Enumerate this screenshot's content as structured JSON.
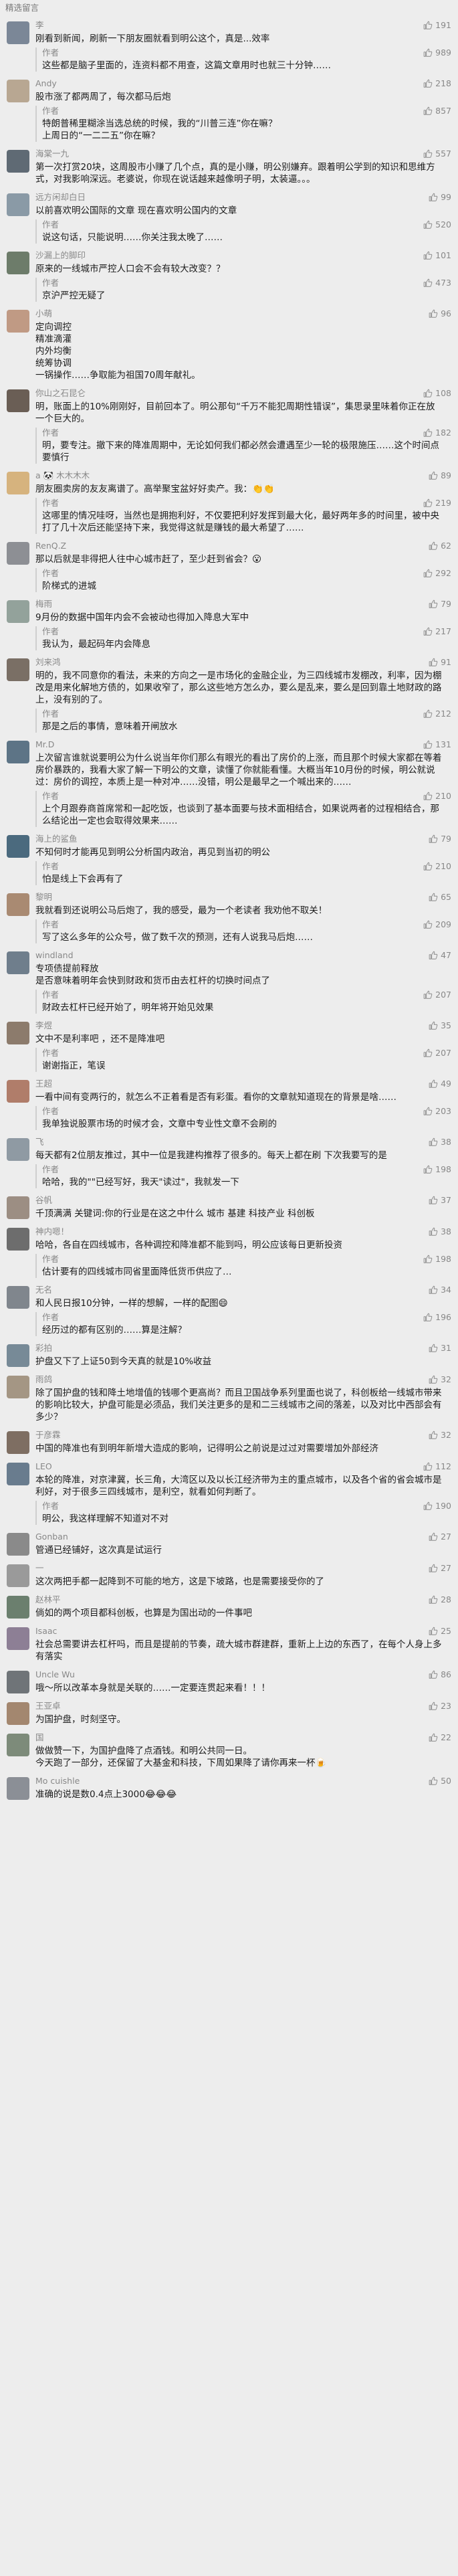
{
  "header": {
    "title": "精选留言"
  },
  "author_label": "作者",
  "comments": [
    {
      "name": "李",
      "likes": "191",
      "avatar_color": "#7b8797",
      "content": "刚看到新闻，刷新一下朋友圈就看到明公这个，真是...效率",
      "reply": {
        "likes": "989",
        "content": "这些都是脑子里面的，连资料都不用查，这篇文章用时也就三十分钟……"
      }
    },
    {
      "name": "Andy",
      "likes": "218",
      "avatar_color": "#b8a792",
      "content": "股市涨了都两周了，每次都马后炮",
      "reply": {
        "likes": "857",
        "content": "特朗普稀里糊涂当选总统的时候，我的“川普三连”你在嘛？\n上周日的“一二二五”你在嘛？"
      }
    },
    {
      "name": "海棠一九",
      "likes": "557",
      "avatar_color": "#5f6a74",
      "content": "第一次打赏20块，这周股市小赚了几个点，真的是小赚，明公别嫌弃。跟着明公学到的知识和思维方式，对我影响深远。老婆说，你现在说话越来越像明子明，太装逼。。。",
      "reply": null
    },
    {
      "name": "远方闲却白日",
      "likes": "99",
      "avatar_color": "#8a9aa6",
      "content": "以前喜欢明公国际的文章  现在喜欢明公国内的文章",
      "reply": {
        "likes": "520",
        "content": "说这句话，只能说明……你关注我太晚了……"
      }
    },
    {
      "name": "沙漏上的脚印",
      "likes": "101",
      "avatar_color": "#6d7c6a",
      "content": "原来的一线城市严控人口会不会有较大改变？？",
      "reply": {
        "likes": "473",
        "content": "京沪严控无疑了"
      }
    },
    {
      "name": "小萌",
      "likes": "96",
      "avatar_color": "#c09a84",
      "content": "定向调控\n精准滴灌\n内外均衡\n统筹协调\n一锅操作……争取能为祖国70周年献礼。",
      "reply": null
    },
    {
      "name": "你山之石昆仑",
      "likes": "108",
      "avatar_color": "#6a5e55",
      "content": "明，账面上的10%刚刚好，目前回本了。明公那句“千万不能犯周期性错误”，集思录里味着你正在放一个巨大的。",
      "reply": {
        "likes": "182",
        "content": "明，要专注。撤下来的降准周期中，无论如何我们都必然会遭遇至少一轮的极限施压……这个时间点要慎行"
      }
    },
    {
      "name": "a 🐼 木木木木",
      "likes": "89",
      "avatar_color": "#d6b37e",
      "content": "朋友圈卖房的友友离谱了。高举聚宝盆好好卖产。我：👏👏",
      "reply": {
        "likes": "219",
        "content": "这哪里的情况哇呀，当然也是拥抱利好，不仅要把利好发挥到最大化，最好两年多的时间里，被中央打了几十次后还能坚持下来，我觉得这就是赚钱的最大希望了……"
      }
    },
    {
      "name": "RenQ.Z",
      "likes": "62",
      "avatar_color": "#8d8f94",
      "content": "那以后就是非得把人往中心城市赶了，至少赶到省会？😮",
      "reply": {
        "likes": "292",
        "content": "阶梯式的进城"
      }
    },
    {
      "name": "梅雨",
      "likes": "79",
      "avatar_color": "#93a29b",
      "content": "9月份的数据中国年内会不会被动也得加入降息大军中",
      "reply": {
        "likes": "217",
        "content": "我认为，最起码年内会降息"
      }
    },
    {
      "name": "刘来鸿",
      "likes": "91",
      "avatar_color": "#7a6f65",
      "content": "明的，我不同意你的看法，未来的方向之一是市场化的金融企业，为三四线城市发棚改，利率，因为棚改是用来化解地方债的，如果收窄了，那么这些地方怎么办，要么是乱来，要么是回到靠土地财政的路上，没有别的了。",
      "reply": {
        "likes": "212",
        "content": "那是之后的事情，意味着开闸放水"
      }
    },
    {
      "name": "Mr.D",
      "likes": "131",
      "avatar_color": "#5d7486",
      "content": "上次留言谁就说要明公为什么说当年你们那么有眼光的看出了房价的上涨，而且那个时候大家都在等着房价暴跌的，我看大家了解一下明公的文章，读懂了你就能看懂。大概当年10月份的时候，明公就说过：房价的调控，本质上是一种对冲……没错，明公是最早之一个喊出来的……",
      "reply": {
        "likes": "210",
        "content": "上个月跟券商首席常和一起吃饭，也谈到了基本面要与技术面相结合，如果说两者的过程相结合，那么结论出一定也会取得效果来……"
      }
    },
    {
      "name": "海上的鲨鱼",
      "likes": "79",
      "avatar_color": "#4b6a7e",
      "content": "不知何时才能再见到明公分析国内政治，再见到当初的明公",
      "reply": {
        "likes": "210",
        "content": "怕是线上下会再有了"
      }
    },
    {
      "name": "黎明",
      "likes": "65",
      "avatar_color": "#a98a72",
      "content": "我就看到还说明公马后炮了，我的感受，最为一个老读者 我劝他不取关！",
      "reply": {
        "likes": "209",
        "content": "写了这么多年的公众号，做了数千次的预测，还有人说我马后炮……"
      }
    },
    {
      "name": "windland",
      "likes": "47",
      "avatar_color": "#6f7e8c",
      "content": "专项债提前释放\n是否意味着明年会快到财政和货币由去杠杆的切换时间点了",
      "reply": {
        "likes": "207",
        "content": "财政去杠杆已经开始了，明年将开始见效果"
      }
    },
    {
      "name": "李煜",
      "likes": "35",
      "avatar_color": "#8c7b6c",
      "content": "文中不是利率吧 ，还不是降准吧",
      "reply": {
        "likes": "207",
        "content": "谢谢指正，笔误"
      }
    },
    {
      "name": "王超",
      "likes": "49",
      "avatar_color": "#b07d6a",
      "content": "一看中间有变两行的，就怎么不正着看是否有彩蛋。看你的文章就知道现在的背景是啥……",
      "reply": {
        "likes": "203",
        "content": "我单独说股票市场的时候才会，文章中专业性文章不会刷的"
      }
    },
    {
      "name": "飞",
      "likes": "38",
      "avatar_color": "#8f9aa3",
      "content": "每天都有2位朋友推过，其中一位是我建构推荐了很多的。每天上都在刷 下次我要写的是",
      "reply": {
        "likes": "198",
        "content": "哈哈，我的\"\"已经写好，我天\"读过\"，我就发一下"
      }
    },
    {
      "name": "谷帆",
      "likes": "37",
      "avatar_color": "#9c8e83",
      "content": "千顶满满 关键词:你的行业是在这之中什么  城市  基建  科技产业  科创板",
      "reply": null
    },
    {
      "name": "神内嗯！",
      "likes": "38",
      "avatar_color": "#6d6d6d",
      "content": "哈哈，各自在四线城市，各种调控和降准都不能到吗，明公应该每日更新投资",
      "reply": {
        "likes": "198",
        "content": "估计要有的四线城市同省里面降低货币供应了…"
      }
    },
    {
      "name": "无名",
      "likes": "34",
      "avatar_color": "#80868d",
      "content": "和人民日报10分钟，一样的想解，一样的配图😄",
      "reply": {
        "likes": "196",
        "content": "经历过的都有区别的……算是注解？"
      }
    },
    {
      "name": "彩拍",
      "likes": "31",
      "avatar_color": "#778a97",
      "content": "护盘又下了上证50到今天真的就是10%收益",
      "reply": null
    },
    {
      "name": "雨鸽",
      "likes": "32",
      "avatar_color": "#a49684",
      "content": "除了国护盘的钱和降土地增值的钱哪个更高尚？而且卫国战争系列里面也说了，科创板给一线城市带来的影响比较大，护盘可能是必须品，我们关注更多的是和二三线城市之间的落差，以及对比中西部会有多少？",
      "reply": null
    },
    {
      "name": "于彦霖",
      "likes": "32",
      "avatar_color": "#7e6e62",
      "content": "中国的降准也有到明年新增大造成的影响，记得明公之前说是过过对需要增加外部经济",
      "reply": null
    },
    {
      "name": "LEO",
      "likes": "112",
      "avatar_color": "#697c8e",
      "content": "本轮的降准，对京津冀，长三角，大湾区以及以长江经济带为主的重点城市，以及各个省的省会城市是利好，对于很多三四线城市，是利空，就看如何判断了。",
      "reply": {
        "likes": "190",
        "content": "明公，我这样理解不知道对不对"
      }
    },
    {
      "name": "Gonban",
      "likes": "27",
      "avatar_color": "#8a8a8a",
      "content": "管通已经铺好，这次真是试运行",
      "reply": null
    },
    {
      "name": "一",
      "likes": "27",
      "avatar_color": "#9a9a9a",
      "content": "这次两把手都一起降到不可能的地方，这是下坡路，也是需要接受你的了",
      "reply": null
    },
    {
      "name": "赵林平",
      "likes": "28",
      "avatar_color": "#6b7f6e",
      "content": "倘如的两个项目都科创板，也算是为国出动的一件事吧",
      "reply": null
    },
    {
      "name": "Isaac",
      "likes": "25",
      "avatar_color": "#8d7f95",
      "content": "社会总需要讲去杠杆吗，而且是提前的节奏，疏大城市群建群，重新上上边的东西了，在每个人身上多有落实",
      "reply": null
    },
    {
      "name": "Uncle Wu",
      "likes": "86",
      "avatar_color": "#6f7478",
      "content": "哦～所以改革本身就是关联的……一定要连贯起来看！！！",
      "reply": null
    },
    {
      "name": "王亚卓",
      "likes": "23",
      "avatar_color": "#a3876f",
      "content": "为国护盘，时刻坚守。",
      "reply": null
    },
    {
      "name": "国",
      "likes": "22",
      "avatar_color": "#7d8b7a",
      "content": "做做赞一下，为国护盘降了点酒钱。和明公共同一日。\n今天跑了一部分，还保留了大基金和科技，下周如果降了请你再来一杯🍺",
      "reply": null
    },
    {
      "name": "Mo cuishle",
      "likes": "50",
      "avatar_color": "#8b8f96",
      "content": "准确的说是数0.4点上3000😂😂😂",
      "reply": null
    }
  ]
}
